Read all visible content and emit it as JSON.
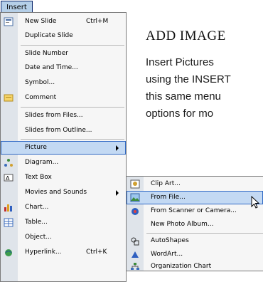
{
  "menubar": {
    "insert_label": "Insert"
  },
  "background": {
    "title": "ADD IMAGE",
    "lines": [
      "Insert Pictures",
      "using the INSERT",
      "this same menu",
      "options for mo"
    ]
  },
  "insert_menu": {
    "items": [
      {
        "label": "New Slide",
        "shortcut": "Ctrl+M",
        "icon": "new-slide-icon"
      },
      {
        "label": "Duplicate Slide"
      },
      {
        "label": "Slide Number"
      },
      {
        "label": "Date and Time..."
      },
      {
        "label": "Symbol..."
      },
      {
        "label": "Comment",
        "icon": "comment-icon"
      },
      {
        "label": "Slides from Files..."
      },
      {
        "label": "Slides from Outline..."
      },
      {
        "label": "Picture",
        "has_submenu": true
      },
      {
        "label": "Diagram...",
        "icon": "diagram-icon"
      },
      {
        "label": "Text Box",
        "icon": "text-box-icon"
      },
      {
        "label": "Movies and Sounds",
        "has_submenu": true
      },
      {
        "label": "Chart...",
        "icon": "chart-icon"
      },
      {
        "label": "Table...",
        "icon": "table-icon"
      },
      {
        "label": "Object..."
      },
      {
        "label": "Hyperlink...",
        "shortcut": "Ctrl+K",
        "icon": "hyperlink-icon"
      }
    ]
  },
  "picture_submenu": {
    "items": [
      {
        "label": "Clip Art...",
        "icon": "clip-art-icon"
      },
      {
        "label": "From File...",
        "icon": "from-file-icon"
      },
      {
        "label": "From Scanner or Camera...",
        "icon": "scanner-icon"
      },
      {
        "label": "New Photo Album..."
      },
      {
        "label": "AutoShapes",
        "icon": "autoshapes-icon"
      },
      {
        "label": "WordArt...",
        "icon": "wordart-icon"
      },
      {
        "label": "Organization Chart",
        "icon": "org-chart-icon"
      }
    ]
  },
  "colors": {
    "highlight": "#c3d9f3",
    "highlight_border": "#316ac5",
    "menu_bg": "#f6f6f6"
  }
}
